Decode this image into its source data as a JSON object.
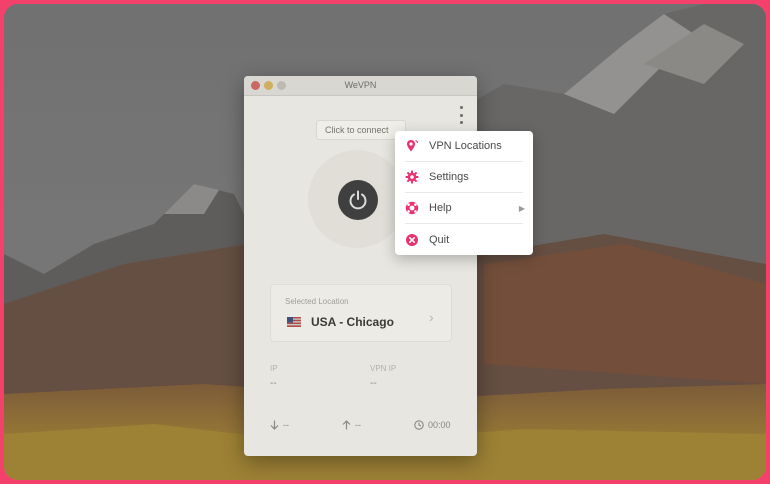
{
  "window": {
    "title": "WeVPN"
  },
  "main": {
    "connect_tooltip": "Click to connect",
    "selected_location_label": "Selected Location",
    "selected_location_name": "USA - Chicago",
    "stats": [
      {
        "label": "IP",
        "value": "--"
      },
      {
        "label": "VPN IP",
        "value": "--"
      }
    ],
    "footer": {
      "download": "--",
      "upload": "--",
      "timer": "00:00"
    }
  },
  "menu": {
    "items": [
      {
        "label": "VPN Locations",
        "icon": "location-pin-icon"
      },
      {
        "label": "Settings",
        "icon": "gear-icon"
      },
      {
        "label": "Help",
        "icon": "lifebuoy-icon",
        "has_submenu": true
      },
      {
        "label": "Quit",
        "icon": "close-circle-icon"
      }
    ]
  },
  "colors": {
    "accent": "#e8336e",
    "frame": "#f4416c",
    "power_button": "#3f3f3f"
  }
}
